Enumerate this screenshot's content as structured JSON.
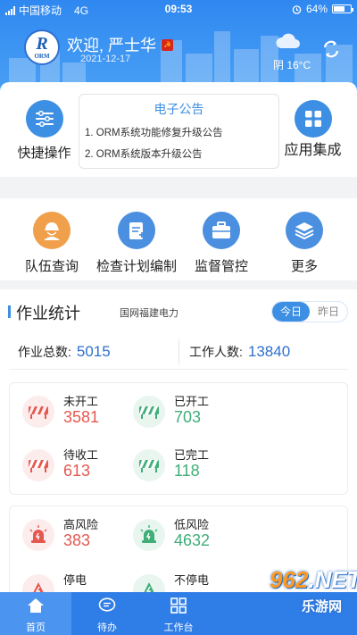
{
  "status_bar": {
    "carrier": "中国移动",
    "network": "4G",
    "time": "09:53",
    "battery": "64%",
    "battery_level": 0.64
  },
  "header": {
    "welcome": "欢迎, 严士华",
    "date": "2021-12-17",
    "weather": "阴 16°C",
    "logo_letter": "R",
    "logo_text": "ORM"
  },
  "quick_actions": {
    "label": "快捷操作",
    "icon": "sliders-icon"
  },
  "app_integration": {
    "label": "应用集成",
    "icon": "grid-icon"
  },
  "notice": {
    "title": "电子公告",
    "items": [
      "1. ORM系统功能修复升级公告",
      "2. ORM系统版本升级公告"
    ]
  },
  "grid": [
    {
      "label": "队伍查询",
      "icon": "worker-icon",
      "color": "#f0a04b"
    },
    {
      "label": "检查计划编制",
      "icon": "plan-edit-icon",
      "color": "#4a8fe0"
    },
    {
      "label": "监督管控",
      "icon": "briefcase-icon",
      "color": "#4a8fe0"
    },
    {
      "label": "更多",
      "icon": "layers-icon",
      "color": "#4a8fe0"
    }
  ],
  "stats": {
    "title": "作业统计",
    "org": "国网福建电力",
    "tabs": [
      "今日",
      "昨日"
    ],
    "total_jobs_label": "作业总数:",
    "total_jobs": "5015",
    "workers_label": "工作人数:",
    "workers": "13840",
    "job_status": [
      {
        "label": "未开工",
        "value": "3581",
        "tone": "red"
      },
      {
        "label": "已开工",
        "value": "703",
        "tone": "green"
      },
      {
        "label": "待收工",
        "value": "613",
        "tone": "red"
      },
      {
        "label": "已完工",
        "value": "118",
        "tone": "green"
      }
    ],
    "risk": [
      {
        "label": "高风险",
        "value": "383",
        "tone": "red"
      },
      {
        "label": "低风险",
        "value": "4632",
        "tone": "green"
      },
      {
        "label": "停电",
        "value": "",
        "tone": "red"
      },
      {
        "label": "不停电",
        "value": "",
        "tone": "green"
      }
    ]
  },
  "tabbar": [
    {
      "label": "首页",
      "icon": "home-icon"
    },
    {
      "label": "待办",
      "icon": "chat-icon"
    },
    {
      "label": "工作台",
      "icon": "grid-icon"
    },
    {
      "label": "",
      "icon": ""
    },
    {
      "label": "",
      "icon": ""
    }
  ],
  "watermark": {
    "num": "962",
    "dot_net": ".NET",
    "cn": "乐游网"
  }
}
